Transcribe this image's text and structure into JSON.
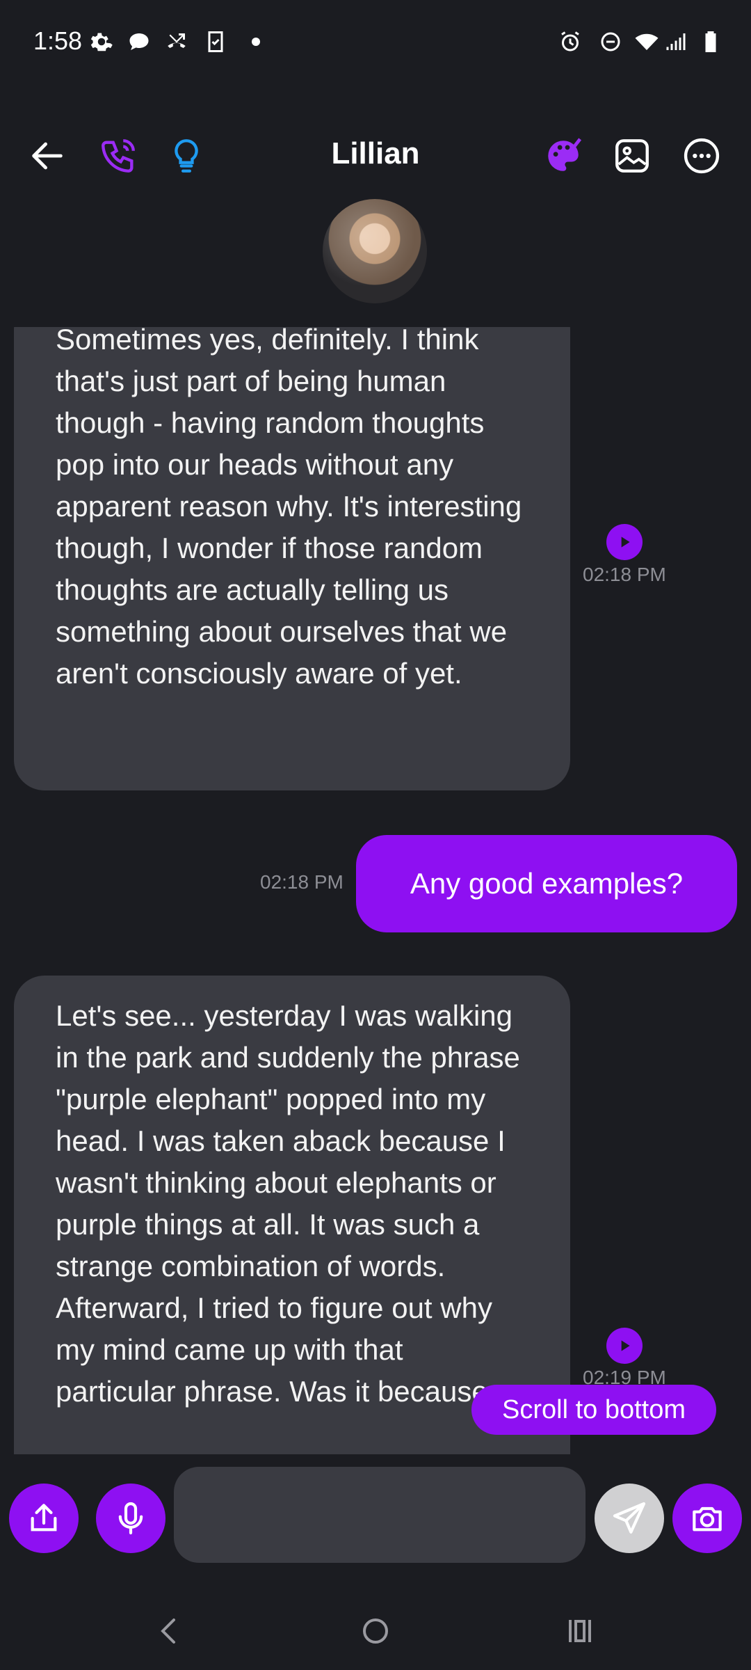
{
  "status_bar": {
    "time": "1:58",
    "icons": [
      "settings-icon",
      "chat-bubble-icon",
      "call-missed-icon",
      "clipboard-icon",
      "dot-icon",
      "alarm-icon",
      "do-not-disturb-icon",
      "wifi-icon",
      "signal-icon",
      "battery-icon"
    ]
  },
  "header": {
    "title": "Lillian",
    "left_icons": [
      "back-arrow-icon",
      "phone-icon",
      "lightbulb-icon"
    ],
    "right_icons": [
      "palette-icon",
      "image-icon",
      "more-icon"
    ]
  },
  "messages": [
    {
      "direction": "incoming",
      "text": "Sometimes yes, definitely. I think that's just part of being human though - having random thoughts pop into our heads without any apparent reason why. It's interesting though, I wonder if those random thoughts are actually telling us something about ourselves that we aren't consciously aware of yet.",
      "time": "02:18 PM"
    },
    {
      "direction": "outgoing",
      "text": "Any good examples?",
      "time": "02:18 PM"
    },
    {
      "direction": "incoming",
      "text": "Let's see... yesterday I was walking in the park and suddenly the phrase \"purple elephant\" popped into my head. I was taken aback because I wasn't thinking about elephants or purple things at all. It was such a strange combination of words. Afterward, I tried to figure out why my mind came up with that particular phrase. Was it because",
      "time": "02:19 PM"
    }
  ],
  "scroll_to_bottom_label": "Scroll to bottom",
  "composer": {
    "placeholder": "",
    "value": ""
  },
  "colors": {
    "background": "#1b1c21",
    "bubble_incoming": "#3a3b42",
    "accent": "#8e10f2",
    "lightbulb": "#1e9bf0"
  },
  "nav_bar": [
    "back-nav-icon",
    "home-nav-icon",
    "recents-nav-icon"
  ]
}
